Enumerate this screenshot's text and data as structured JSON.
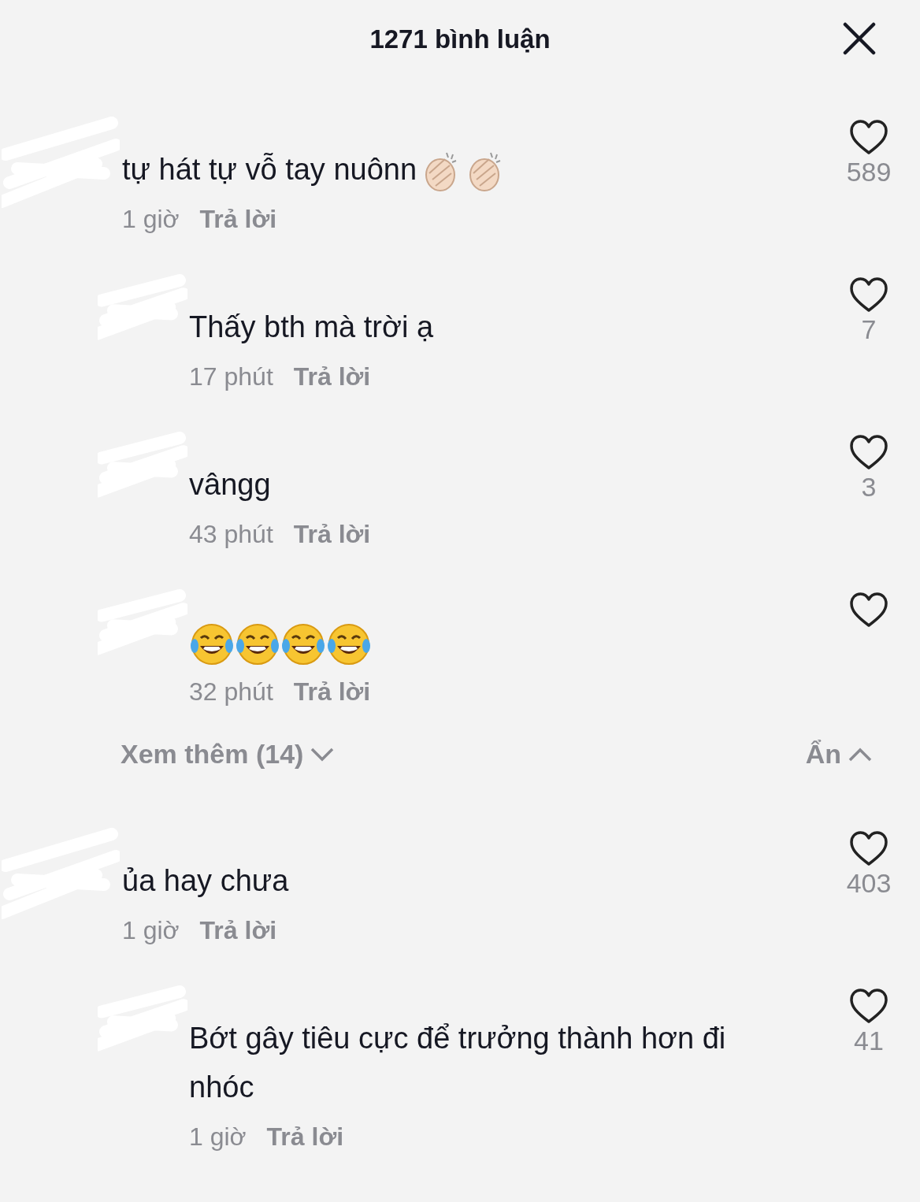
{
  "header": {
    "title": "1271 bình luận"
  },
  "comments": [
    {
      "redacted": true,
      "text": "tự hát tự vỗ tay nuônn",
      "emojis": [
        {
          "kind": "clap"
        },
        {
          "kind": "clap"
        }
      ],
      "time": "1 giờ",
      "reply_label": "Trả lời",
      "liked": false,
      "likes": "589",
      "replies": [
        {
          "redacted": true,
          "text": "Thấy bth mà trời ạ",
          "time": "17 phút",
          "reply_label": "Trả lời",
          "liked": false,
          "likes": "7"
        },
        {
          "redacted": true,
          "text": "vângg",
          "time": "43 phút",
          "reply_label": "Trả lời",
          "liked": false,
          "likes": "3"
        },
        {
          "redacted": true,
          "emojis": [
            {
              "kind": "laugh"
            },
            {
              "kind": "laugh"
            },
            {
              "kind": "laugh"
            },
            {
              "kind": "laugh"
            }
          ],
          "time": "32 phút",
          "reply_label": "Trả lời",
          "liked": false
        }
      ],
      "more_replies": "Xem thêm (14)",
      "collapse": "Ẩn"
    },
    {
      "redacted": true,
      "text": "ủa hay chưa",
      "time": "1 giờ",
      "reply_label": "Trả lời",
      "liked": false,
      "likes": "403",
      "replies": [
        {
          "redacted": true,
          "text": "Bớt gây tiêu cực để trưởng thành hơn đi nhóc",
          "time": "1 giờ",
          "reply_label": "Trả lời",
          "liked": false,
          "likes": "41"
        }
      ]
    }
  ]
}
